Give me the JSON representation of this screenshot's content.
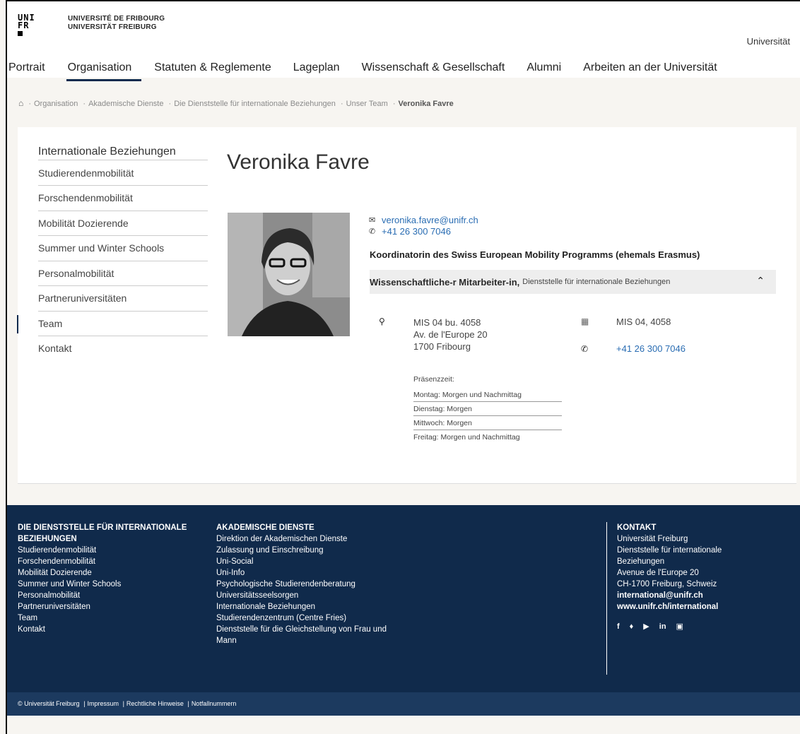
{
  "header": {
    "logo_mark_line1": "UNI",
    "logo_mark_line2": "FR",
    "logo_line1": "UNIVERSITÉ DE FRIBOURG",
    "logo_line2": "UNIVERSITÄT FREIBURG",
    "right_link": "Universität"
  },
  "nav": [
    {
      "label": "Portrait"
    },
    {
      "label": "Organisation"
    },
    {
      "label": "Statuten & Reglemente"
    },
    {
      "label": "Lageplan"
    },
    {
      "label": "Wissenschaft & Gesellschaft"
    },
    {
      "label": "Alumni"
    },
    {
      "label": "Arbeiten an der Universität"
    }
  ],
  "breadcrumb": {
    "items": [
      "Organisation",
      "Akademische Dienste",
      "Die Dienststelle für internationale Beziehungen",
      "Unser Team"
    ],
    "current": "Veronika Favre"
  },
  "sidenav": {
    "title": "Internationale Beziehungen",
    "items": [
      "Studierendenmobilität",
      "Forschendenmobilität",
      "Mobilität Dozierende",
      "Summer und Winter Schools",
      "Personalmobilität",
      "Partneruniversitäten",
      "Team",
      "Kontakt"
    ]
  },
  "person": {
    "name": "Veronika Favre",
    "email": "veronika.favre@unifr.ch",
    "phone": "+41 26 300 7046",
    "role_main": "Koordinatorin des Swiss European Mobility Programms (ehemals Erasmus)",
    "role_title": "Wissenschaftliche-r Mitarbeiter-in,",
    "role_unit": "Dienststelle für internationale Beziehungen",
    "address_line1": "MIS 04 bu. 4058",
    "address_line2": "Av. de l'Europe 20",
    "address_line3": "1700 Fribourg",
    "room": "MIS 04, 4058",
    "phone2": "+41 26 300 7046",
    "presence_heading": "Präsenzzeit:",
    "presence": [
      "Montag: Morgen und Nachmittag",
      "Dienstag: Morgen",
      "Mittwoch: Morgen",
      "Freitag: Morgen und Nachmittag"
    ]
  },
  "footer": {
    "col1_heading": "DIE DIENSTSTELLE FÜR INTERNATIONALE BEZIEHUNGEN",
    "col1_items": [
      "Studierendenmobilität",
      "Forschendenmobilität",
      "Mobilität Dozierende",
      "Summer und Winter Schools",
      "Personalmobilität",
      "Partneruniversitäten",
      "Team",
      "Kontakt"
    ],
    "col2_heading": "AKADEMISCHE DIENSTE",
    "col2_items": [
      "Direktion der Akademischen Dienste",
      "Zulassung und Einschreibung",
      "Uni-Social",
      "Uni-Info",
      "Psychologische Studierendenberatung",
      "Universitätsseelsorgen",
      "Internationale Beziehungen",
      "Studierendenzentrum (Centre Fries)",
      "Dienststelle für die Gleichstellung von Frau und Mann"
    ],
    "contact_heading": "KONTAKT",
    "contact_lines": [
      "Universität Freiburg",
      "Dienststelle für internationale Beziehungen",
      "Avenue de l'Europe 20",
      "CH-1700 Freiburg, Schweiz"
    ],
    "contact_email": "international@unifr.ch",
    "contact_web": "www.unifr.ch/international",
    "social": [
      "f",
      "♦",
      "▶",
      "in",
      "▣"
    ],
    "bottom_copyright": "© Universität Freiburg",
    "bottom_links": [
      "Impressum",
      "Rechtliche Hinweise",
      "Notfallnummern"
    ]
  },
  "colors": {
    "footer_bg": "#102a4b",
    "link": "#2a6db3",
    "accent": "#0d2a4e"
  }
}
